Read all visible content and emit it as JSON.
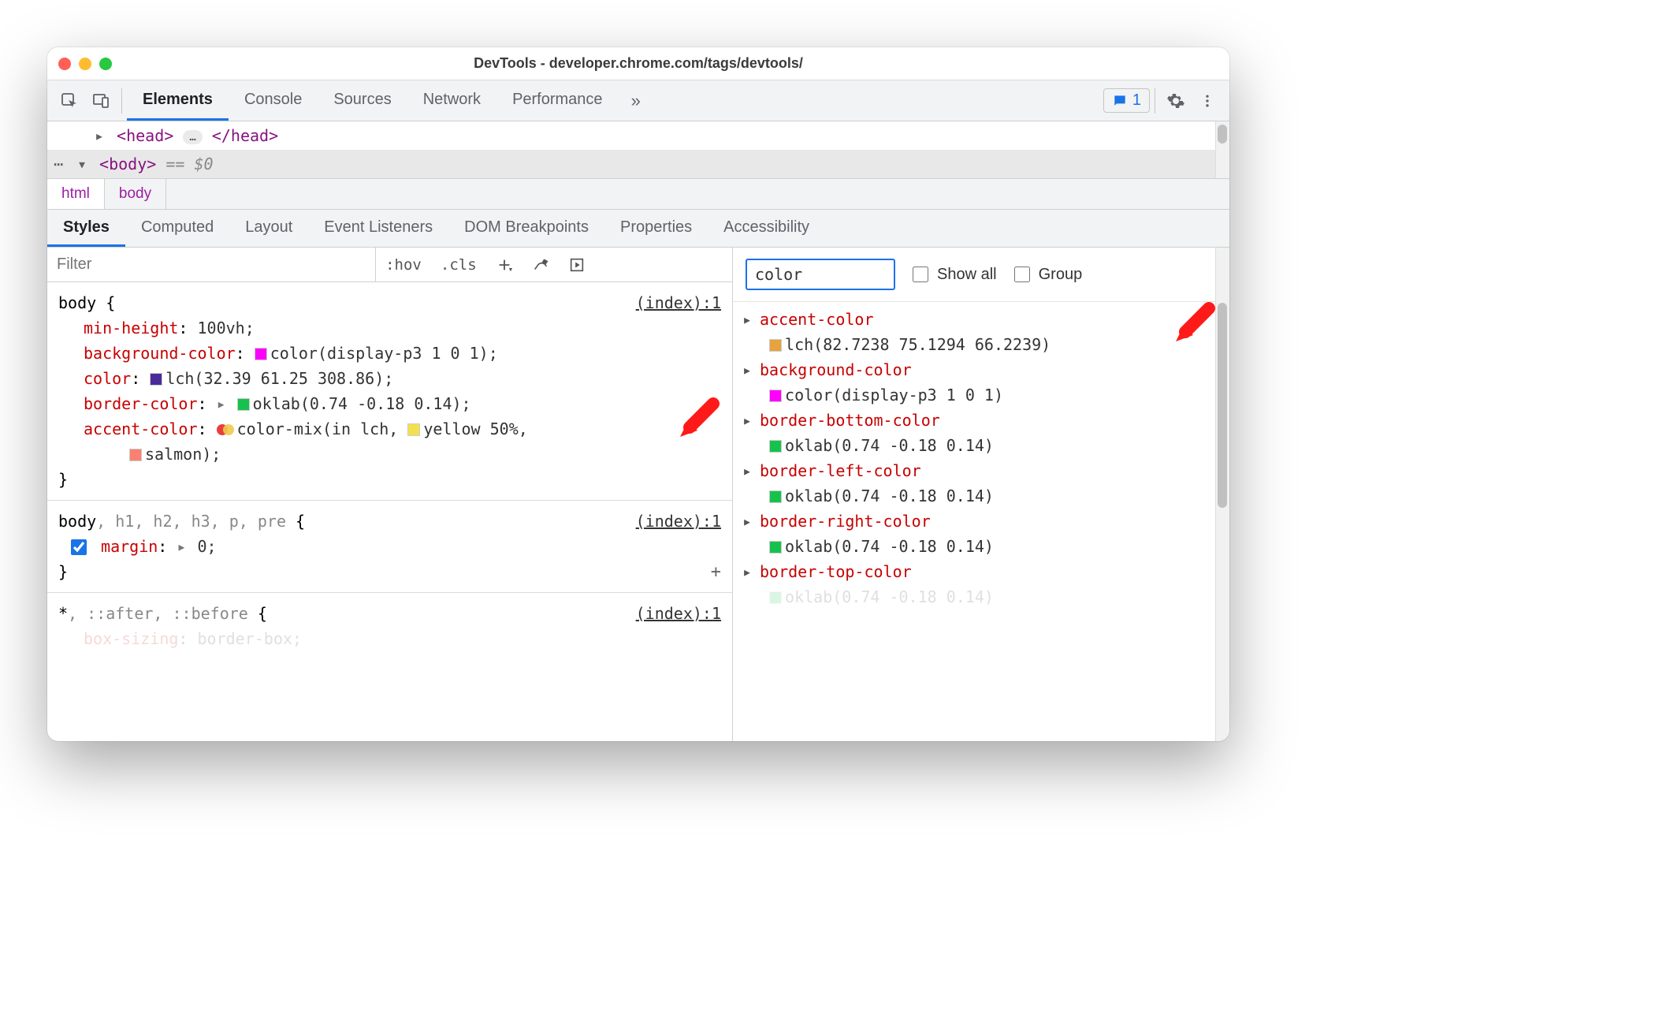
{
  "window": {
    "title": "DevTools - developer.chrome.com/tags/devtools/"
  },
  "tabs": [
    "Elements",
    "Console",
    "Sources",
    "Network",
    "Performance"
  ],
  "active_tab": "Elements",
  "issues_count": "1",
  "dom": {
    "head_open": "<head>",
    "head_close": "</head>",
    "ellipsis": "…",
    "body_open": "<body>",
    "body_suffix": " == $0"
  },
  "breadcrumbs": [
    "html",
    "body"
  ],
  "subtabs": [
    "Styles",
    "Computed",
    "Layout",
    "Event Listeners",
    "DOM Breakpoints",
    "Properties",
    "Accessibility"
  ],
  "active_subtab": "Styles",
  "styles_toolbar": {
    "filter_placeholder": "Filter",
    "hov": ":hov",
    "cls": ".cls"
  },
  "rules": [
    {
      "selector": "body {",
      "source": "(index):1",
      "props": [
        {
          "name": "min-height",
          "value": "100vh;",
          "swatch": null
        },
        {
          "name": "background-color",
          "value": "color(display-p3 1 0 1);",
          "swatch": "#ff00ff"
        },
        {
          "name": "color",
          "value": "lch(32.39 61.25 308.86);",
          "swatch": "#4b2a9a"
        },
        {
          "name": "border-color",
          "value": "oklab(0.74 -0.18 0.14);",
          "swatch": "#16c24c",
          "tri": true
        },
        {
          "name": "accent-color",
          "value": "color-mix(in lch, ",
          "mix": true,
          "mix_mid_sw": "#f4e04d",
          "mix_mid": "yellow 50%,"
        },
        {
          "name": "",
          "value": "salmon);",
          "swatch": "#fa8072",
          "cont": true
        }
      ],
      "close": "}"
    },
    {
      "selector_full": "body, h1, h2, h3, p, pre {",
      "selector_main": "body",
      "selector_dim": ", h1, h2, h3, p, pre",
      "source": "(index):1",
      "props": [
        {
          "name": "margin",
          "value": "0;",
          "tri": true,
          "checked": true
        }
      ],
      "close": "}",
      "plus": true
    },
    {
      "selector_full": "*, ::after, ::before {",
      "selector_main": "*",
      "selector_dim": ", ::after, ::before",
      "source": "(index):1",
      "props": [
        {
          "name": "box-sizing",
          "value": "border-box;"
        }
      ],
      "close": "",
      "cutoff": true
    }
  ],
  "computed": {
    "filter_value": "color",
    "show_all": "Show all",
    "group": "Group",
    "items": [
      {
        "name": "accent-color",
        "value": "lch(82.7238 75.1294 66.2239)",
        "sw": "#e8a23e"
      },
      {
        "name": "background-color",
        "value": "color(display-p3 1 0 1)",
        "sw": "#ff00ff"
      },
      {
        "name": "border-bottom-color",
        "value": "oklab(0.74 -0.18 0.14)",
        "sw": "#16c24c"
      },
      {
        "name": "border-left-color",
        "value": "oklab(0.74 -0.18 0.14)",
        "sw": "#16c24c"
      },
      {
        "name": "border-right-color",
        "value": "oklab(0.74 -0.18 0.14)",
        "sw": "#16c24c"
      },
      {
        "name": "border-top-color",
        "value": "oklab(0.74 -0.18 0.14)",
        "sw": "#16c24c",
        "cutoff": true
      }
    ]
  }
}
